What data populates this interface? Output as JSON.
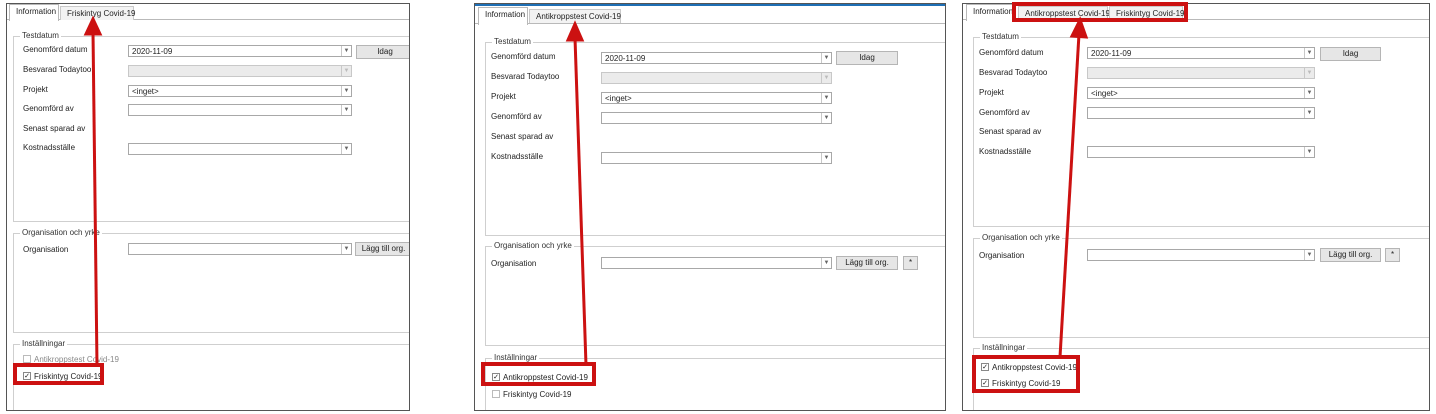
{
  "panels": [
    {
      "tabs": [
        "Information",
        "Friskintyg Covid-19"
      ],
      "group1_title": "Testdatum",
      "labels": {
        "date": "Genomförd datum",
        "answered": "Besvarad Todaytoo",
        "project": "Projekt",
        "performed_by": "Genomförd av",
        "last_saved": "Senast sparad av",
        "cost_center": "Kostnadsställe"
      },
      "date_value": "2020-11-09",
      "today_button": "Idag",
      "project_value": "<inget>",
      "group2_title": "Organisation och yrke",
      "org_label": "Organisation",
      "add_org_button": "Lägg till org.",
      "star_button": "*",
      "group3_title": "Inställningar",
      "checkboxes": [
        {
          "label": "Antikroppstest Covid-19",
          "checked": false
        },
        {
          "label": "Friskintyg Covid-19",
          "checked": true
        }
      ]
    },
    {
      "tabs": [
        "Information",
        "Antikroppstest Covid-19"
      ],
      "group1_title": "Testdatum",
      "labels": {
        "date": "Genomförd datum",
        "answered": "Besvarad Todaytoo",
        "project": "Projekt",
        "performed_by": "Genomförd av",
        "last_saved": "Senast sparad av",
        "cost_center": "Kostnadsställe"
      },
      "date_value": "2020-11-09",
      "today_button": "Idag",
      "project_value": "<inget>",
      "group2_title": "Organisation och yrke",
      "org_label": "Organisation",
      "add_org_button": "Lägg till org.",
      "star_button": "*",
      "group3_title": "Inställningar",
      "checkboxes": [
        {
          "label": "Antikroppstest Covid-19",
          "checked": true
        },
        {
          "label": "Friskintyg Covid-19",
          "checked": false
        }
      ]
    },
    {
      "tabs": [
        "Information",
        "Antikroppstest Covid-19",
        "Friskintyg Covid-19"
      ],
      "group1_title": "Testdatum",
      "labels": {
        "date": "Genomförd datum",
        "answered": "Besvarad Todaytoo",
        "project": "Projekt",
        "performed_by": "Genomförd av",
        "last_saved": "Senast sparad av",
        "cost_center": "Kostnadsställe"
      },
      "date_value": "2020-11-09",
      "today_button": "Idag",
      "project_value": "<inget>",
      "group2_title": "Organisation och yrke",
      "org_label": "Organisation",
      "add_org_button": "Lägg till org.",
      "star_button": "*",
      "group3_title": "Inställningar",
      "checkboxes": [
        {
          "label": "Antikroppstest Covid-19",
          "checked": true
        },
        {
          "label": "Friskintyg Covid-19",
          "checked": true
        }
      ]
    }
  ],
  "colors": {
    "highlight": "#cc1111",
    "tab_strip_accent": "#1f6fb5"
  }
}
